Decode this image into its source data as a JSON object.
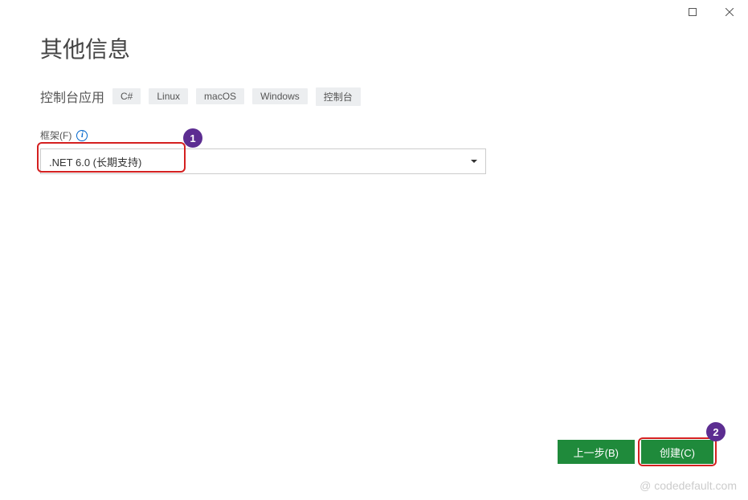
{
  "window": {
    "maximize_title": "maximize",
    "close_title": "close"
  },
  "page": {
    "title": "其他信息",
    "subtitle": "控制台应用",
    "tags": [
      "C#",
      "Linux",
      "macOS",
      "Windows",
      "控制台"
    ]
  },
  "framework": {
    "label": "框架(F)",
    "selected": ".NET 6.0 (长期支持)"
  },
  "annotations": {
    "badge1": "1",
    "badge2": "2"
  },
  "footer": {
    "back": "上一步(B)",
    "create": "创建(C)"
  },
  "watermark": "@ codedefault.com"
}
